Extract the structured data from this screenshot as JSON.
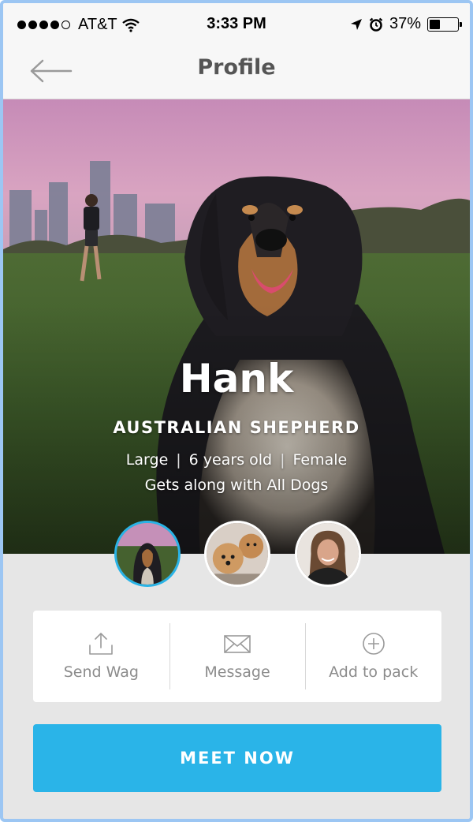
{
  "status_bar": {
    "carrier": "AT&T",
    "time": "3:33 PM",
    "battery": "37%",
    "battery_level": 0.37,
    "icons": [
      "signal-dots-icon",
      "wifi-icon",
      "location-arrow-icon",
      "alarm-icon",
      "battery-icon"
    ]
  },
  "nav": {
    "title": "Profile",
    "back_icon": "back-arrow-icon"
  },
  "profile": {
    "name": "Hank",
    "breed": "AUSTRALIAN SHEPHERD",
    "size": "Large",
    "age": "6 years old",
    "sex": "Female",
    "compatibility": "Gets along with All Dogs"
  },
  "avatars": [
    {
      "subject": "dog-photo",
      "active": true
    },
    {
      "subject": "two-dogs-photo",
      "active": false
    },
    {
      "subject": "owner-photo",
      "active": false
    }
  ],
  "actions": {
    "send_wag": {
      "label": "Send Wag",
      "icon": "share-upload-icon"
    },
    "message": {
      "label": "Message",
      "icon": "envelope-icon"
    },
    "add_to_pack": {
      "label": "Add to pack",
      "icon": "plus-circle-icon"
    }
  },
  "cta": {
    "label": "MEET NOW"
  },
  "colors": {
    "accent": "#2ab4e8",
    "active_avatar_ring": "#29b3e6",
    "nav_title": "#555555",
    "action_text": "#8c8c8c",
    "background": "#e6e6e6"
  }
}
